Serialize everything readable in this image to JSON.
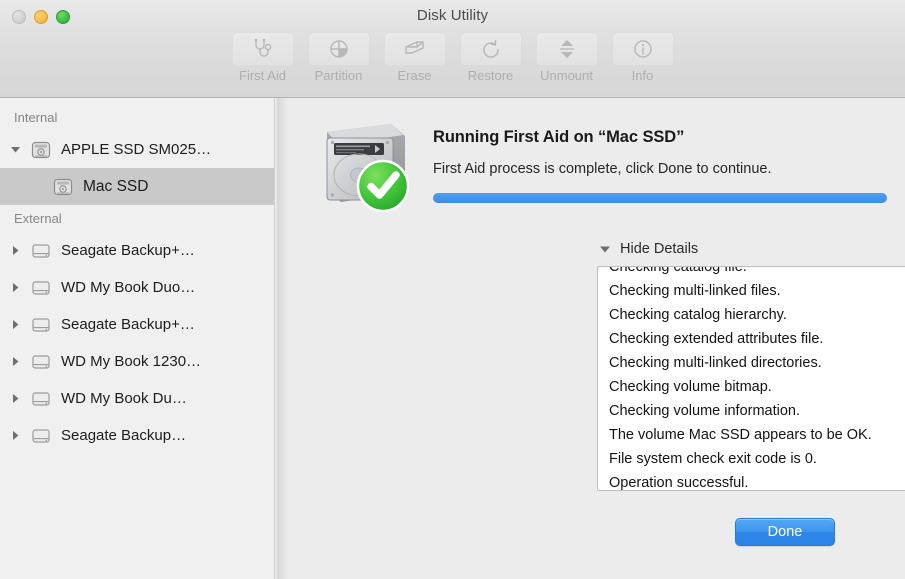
{
  "window": {
    "title": "Disk Utility",
    "traffic_lights": [
      {
        "name": "close-button",
        "state": "disabled",
        "color": "#cfcfcf"
      },
      {
        "name": "minimize-button",
        "state": "enabled",
        "color": "#f6bb4b"
      },
      {
        "name": "zoom-button",
        "state": "enabled",
        "color": "#3cbf43"
      }
    ]
  },
  "toolbar": {
    "items": [
      {
        "label": "First Aid",
        "icon": "stethoscope-icon",
        "enabled": false
      },
      {
        "label": "Partition",
        "icon": "pie-chart-icon",
        "enabled": false
      },
      {
        "label": "Erase",
        "icon": "erase-pencil-icon",
        "enabled": false
      },
      {
        "label": "Restore",
        "icon": "undo-arrow-icon",
        "enabled": false
      },
      {
        "label": "Unmount",
        "icon": "eject-icon",
        "enabled": false
      },
      {
        "label": "Info",
        "icon": "info-circle-icon",
        "enabled": false
      }
    ]
  },
  "sidebar": {
    "sections": [
      {
        "header": "Internal",
        "items": [
          {
            "label": "APPLE SSD SM025…",
            "icon": "internal-disk-icon",
            "twisty": "down",
            "selected": false,
            "child": false
          },
          {
            "label": "Mac SSD",
            "icon": "internal-disk-icon",
            "twisty": "none",
            "selected": true,
            "child": true
          }
        ]
      },
      {
        "header": "External",
        "items": [
          {
            "label": "Seagate Backup+…",
            "icon": "external-disk-icon",
            "twisty": "right",
            "selected": false,
            "child": false
          },
          {
            "label": "WD My Book Duo…",
            "icon": "external-disk-icon",
            "twisty": "right",
            "selected": false,
            "child": false
          },
          {
            "label": "Seagate Backup+…",
            "icon": "external-disk-icon",
            "twisty": "right",
            "selected": false,
            "child": false
          },
          {
            "label": "WD My Book 1230…",
            "icon": "external-disk-icon",
            "twisty": "right",
            "selected": false,
            "child": false
          },
          {
            "label": "WD My Book Du…",
            "icon": "external-disk-icon",
            "twisty": "right",
            "selected": false,
            "child": false
          },
          {
            "label": "Seagate Backup…",
            "icon": "external-disk-icon",
            "twisty": "right",
            "selected": false,
            "child": false
          }
        ]
      }
    ]
  },
  "main": {
    "status_icon": "hard-drive-with-success-check-icon",
    "title": "Running First Aid on “Mac SSD”",
    "subtitle": "First Aid process is complete, click Done to continue.",
    "progress": {
      "percent": 100,
      "fill_color": "#3d95ee"
    },
    "disclosure": {
      "label": "Hide Details",
      "state": "expanded",
      "icon": "triangle-down-icon"
    },
    "log": {
      "clipped_top_line": "Checking catalog file.",
      "lines": [
        "Checking multi-linked files.",
        "Checking catalog hierarchy.",
        "Checking extended attributes file.",
        "Checking multi-linked directories.",
        "Checking volume bitmap.",
        "Checking volume information.",
        "The volume Mac SSD appears to be OK.",
        "File system check exit code is 0.",
        "Operation successful."
      ],
      "scroll_position": "bottom"
    },
    "done_button": "Done"
  }
}
